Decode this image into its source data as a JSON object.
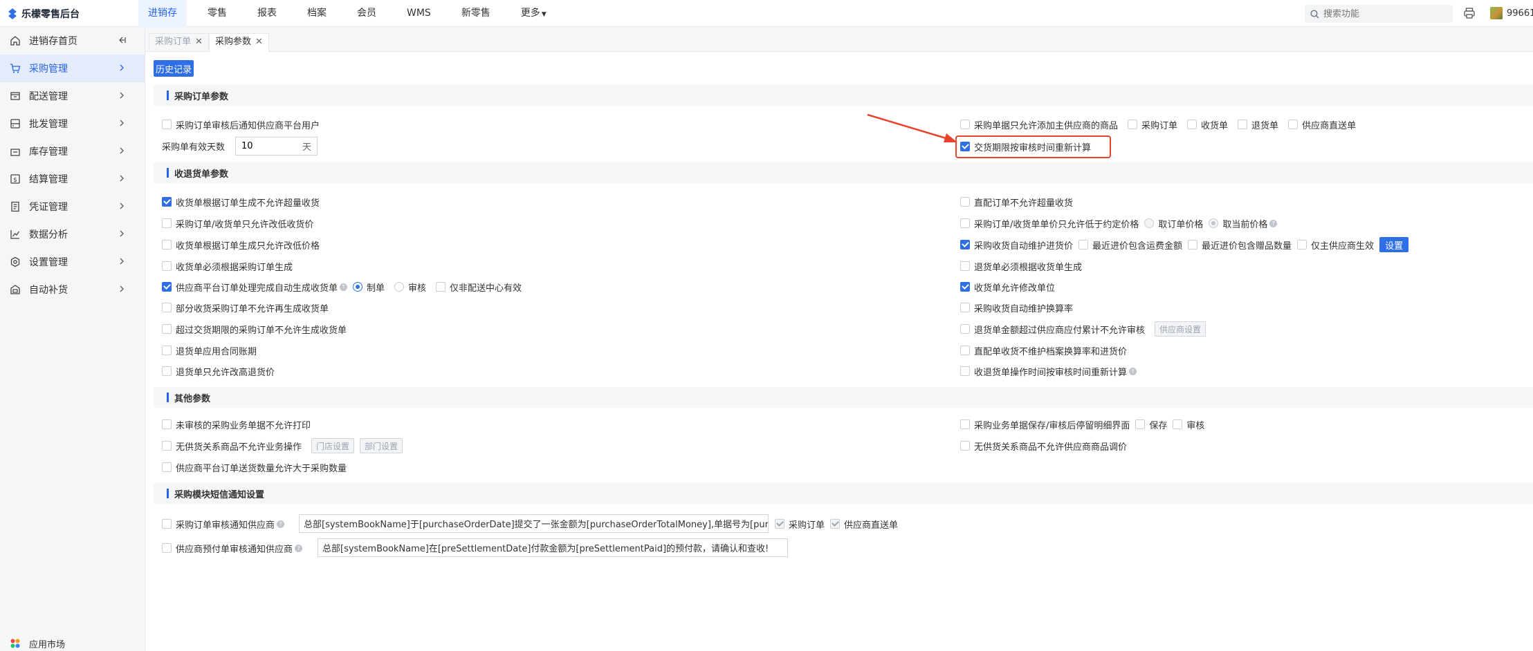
{
  "app": {
    "title": "乐檬零售后台",
    "brand_color": "#2f6fe6"
  },
  "topnav": {
    "items": [
      "进销存",
      "零售",
      "报表",
      "档案",
      "会员",
      "WMS",
      "新零售",
      "更多"
    ]
  },
  "search": {
    "placeholder": "搜索功能"
  },
  "user": {
    "id": "99661"
  },
  "sidebar": {
    "items": [
      {
        "label": "进销存首页"
      },
      {
        "label": "采购管理"
      },
      {
        "label": "配送管理"
      },
      {
        "label": "批发管理"
      },
      {
        "label": "库存管理"
      },
      {
        "label": "结算管理"
      },
      {
        "label": "凭证管理"
      },
      {
        "label": "数据分析"
      },
      {
        "label": "设置管理"
      },
      {
        "label": "自动补货"
      }
    ],
    "bottom": "应用市场"
  },
  "tabs": [
    "采购订单",
    "采购参数"
  ],
  "history_button": "历史记录",
  "sections": {
    "purchase_order": {
      "title": "采购订单参数",
      "notify_supplier": "采购订单审核后通知供应商平台用户",
      "valid_days_label": "采购单有效天数",
      "valid_days_value": "10",
      "valid_days_unit": "天",
      "main_supplier_only": "采购单据只允许添加主供应商的商品",
      "opt_purchase_order": "采购订单",
      "opt_receipt": "收货单",
      "opt_return": "退货单",
      "opt_direct": "供应商直送单",
      "recalc_delivery": "交货期限按审核时间重新计算"
    },
    "receive_return": {
      "title": "收退货单参数",
      "l1": "收货单根据订单生成不允许超量收货",
      "l2": "采购订单/收货单只允许改低收货价",
      "l3": "收货单根据订单生成只允许改低价格",
      "l4": "收货单必须根据采购订单生成",
      "l5": "供应商平台订单处理完成自动生成收货单",
      "l5_make": "制单",
      "l5_audit": "审核",
      "l5_center": "仅非配送中心有效",
      "l6": "部分收货采购订单不允许再生成收货单",
      "l7": "超过交货期限的采购订单不允许生成收货单",
      "l8": "退货单应用合同账期",
      "l9": "退货单只允许改高退货价",
      "r1": "直配订单不允许超量收货",
      "r2": "采购订单/收货单单价只允许低于约定价格",
      "r2_order": "取订单价格",
      "r2_current": "取当前价格",
      "r3": "采购收货自动维护进货价",
      "r3_freight": "最近进价包含运费金额",
      "r3_gift": "最近进价包含赠品数量",
      "r3_main": "仅主供应商生效",
      "r3_setting": "设置",
      "r4": "退货单必须根据收货单生成",
      "r5": "收货单允许修改单位",
      "r6": "采购收货自动维护换算率",
      "r7": "退货单金额超过供应商应付累计不允许审核",
      "r7_btn": "供应商设置",
      "r8": "直配单收货不维护档案换算率和进货价",
      "r9": "收退货单操作时间按审核时间重新计算"
    },
    "other": {
      "title": "其他参数",
      "l1": "未审核的采购业务单据不允许打印",
      "l2": "无供货关系商品不允许业务操作",
      "l2_store": "门店设置",
      "l2_dept": "部门设置",
      "l3": "供应商平台订单送货数量允许大于采购数量",
      "r1": "采购业务单据保存/审核后停留明细界面",
      "r1_save": "保存",
      "r1_audit": "审核",
      "r2": "无供货关系商品不允许供应商商品调价"
    },
    "sms": {
      "title": "采购模块短信通知设置",
      "row1_label": "采购订单审核通知供应商",
      "row1_text": "总部[systemBookName]于[purchaseOrderDate]提交了一张金额为[purchaseOrderTotalMoney],单据号为[purc",
      "row1_opt1": "采购订单",
      "row1_opt2": "供应商直送单",
      "row2_label": "供应商预付单审核通知供应商",
      "row2_text": "总部[systemBookName]在[preSettlementDate]付款金额为[preSettlementPaid]的预付款，请确认和查收!"
    }
  }
}
